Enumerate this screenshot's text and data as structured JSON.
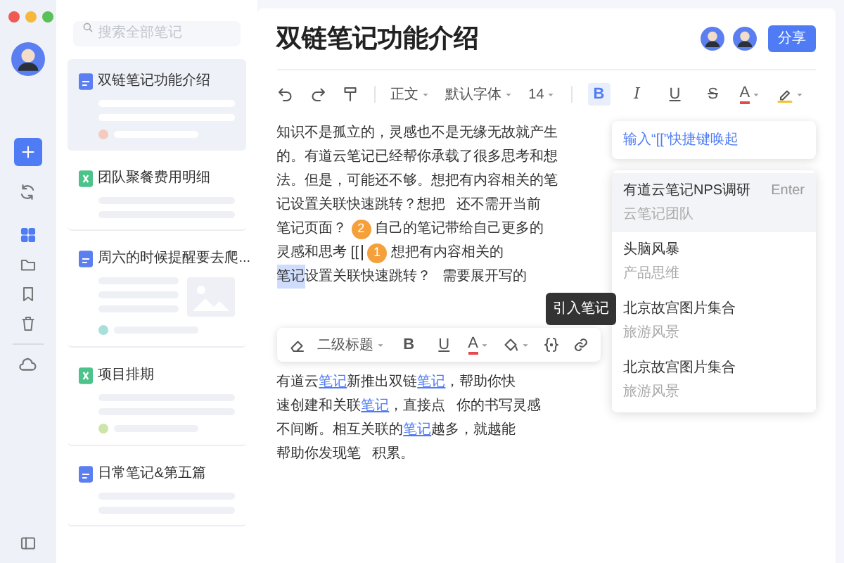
{
  "search": {
    "placeholder": "搜索全部笔记"
  },
  "nav": [
    {
      "kind": "grid",
      "selected": true
    },
    {
      "kind": "folder",
      "selected": false
    },
    {
      "kind": "bookmark",
      "selected": false
    },
    {
      "kind": "trash",
      "selected": false
    }
  ],
  "notes": [
    {
      "title": "双链笔记功能介绍",
      "kind": "doc",
      "selected": true,
      "thumbnail": false,
      "color": "#f6cbbd"
    },
    {
      "title": "团队聚餐费用明细",
      "kind": "sheet",
      "selected": false,
      "thumbnail": false
    },
    {
      "title": "周六的时候提醒要去爬...",
      "kind": "doc",
      "selected": false,
      "thumbnail": true,
      "color": "#a6e0da"
    },
    {
      "title": "项目排期",
      "kind": "sheet",
      "selected": false,
      "thumbnail": false,
      "color": "#cde5a8"
    },
    {
      "title": "日常笔记&第五篇",
      "kind": "doc",
      "selected": false,
      "thumbnail": false
    }
  ],
  "document": {
    "title": "双链笔记功能介绍",
    "share": "分享",
    "toolbar": [
      {
        "kind": "undo"
      },
      {
        "kind": "redo"
      },
      {
        "kind": "painter"
      },
      {
        "kind": "separator"
      },
      {
        "kind": "dropdown",
        "label": "正文"
      },
      {
        "kind": "dropdown",
        "label": "默认字体"
      },
      {
        "kind": "dropdown",
        "label": "14"
      },
      {
        "kind": "separator"
      },
      {
        "kind": "bold",
        "label": "B",
        "selected": true
      },
      {
        "kind": "italic",
        "label": "I",
        "selected": false
      },
      {
        "kind": "underline",
        "label": "U",
        "selected": false
      },
      {
        "kind": "strike",
        "label": "S",
        "selected": false
      },
      {
        "kind": "text_color",
        "label": "A"
      },
      {
        "kind": "highlight"
      }
    ],
    "paragraphs": [
      [
        [
          {
            "kind": "text",
            "text": "知识不是孤立的，灵感也不是无缘无故就产生"
          }
        ],
        [
          {
            "kind": "text",
            "text": "的。有道云笔记已经帮你承载了很多思考和想"
          }
        ],
        [
          {
            "kind": "text",
            "text": "法。但是，可能还不够。想把有内容相关的笔"
          }
        ],
        [
          {
            "kind": "text",
            "text": "记设置关联快速跳转？想把"
          },
          {
            "kind": "text",
            "text": "还不需开当前"
          }
        ],
        [
          {
            "kind": "text",
            "text": "笔记页面？"
          },
          {
            "kind": "badge",
            "text": "2"
          },
          {
            "kind": "text",
            "text": "自己的笔记带给自己更多的"
          }
        ],
        [
          {
            "kind": "text",
            "text": "灵感和思考 [["
          },
          {
            "kind": "cursor"
          },
          {
            "kind": "badge",
            "text": "1"
          },
          {
            "kind": "text",
            "text": "想把有内容相关的"
          }
        ],
        [
          {
            "kind": "highlight",
            "text": "笔记"
          },
          {
            "kind": "text",
            "text": "设置关联快速跳转？"
          },
          {
            "kind": "text",
            "text": "需要展开写的"
          }
        ]
      ],
      [
        [
          {
            "kind": "text",
            "text": "有道云"
          },
          {
            "kind": "link",
            "text": "笔记"
          },
          {
            "kind": "text",
            "text": "新推出双链"
          },
          {
            "kind": "link",
            "text": "笔记"
          },
          {
            "kind": "text",
            "text": "，帮助你快"
          }
        ],
        [
          {
            "kind": "text",
            "text": "速创建和关联"
          },
          {
            "kind": "link",
            "text": "笔记"
          },
          {
            "kind": "text",
            "text": "，直接点"
          },
          {
            "kind": "text",
            "text": "你的书写灵感"
          }
        ],
        [
          {
            "kind": "text",
            "text": "不间断。相互关联的"
          },
          {
            "kind": "link",
            "text": "笔记"
          },
          {
            "kind": "text",
            "text": "越多，就越能"
          }
        ],
        [
          {
            "kind": "text",
            "text": "帮助你发现笔"
          },
          {
            "kind": "text",
            "text": "积累。"
          }
        ]
      ]
    ],
    "float_toolbar": [
      {
        "kind": "eraser"
      },
      {
        "kind": "dropdown",
        "label": "二级标题"
      },
      {
        "kind": "bold",
        "label": "B"
      },
      {
        "kind": "underline",
        "label": "U"
      },
      {
        "kind": "text_color",
        "label": "A"
      },
      {
        "kind": "fill"
      },
      {
        "kind": "braces"
      },
      {
        "kind": "link",
        "tooltip": "引入笔记"
      }
    ],
    "hint": "输入“[[”快捷键唤起",
    "suggestions": [
      {
        "title": "有道云笔记NPS调研",
        "subtitle": "云笔记团队",
        "shortcut": "Enter",
        "selected": true
      },
      {
        "title": "头脑风暴",
        "subtitle": "产品思维",
        "selected": false
      },
      {
        "title": "北京故宫图片集合",
        "subtitle": "旅游风景",
        "selected": false
      },
      {
        "title": "北京故宫图片集合",
        "subtitle": "旅游风景",
        "selected": false
      }
    ]
  }
}
